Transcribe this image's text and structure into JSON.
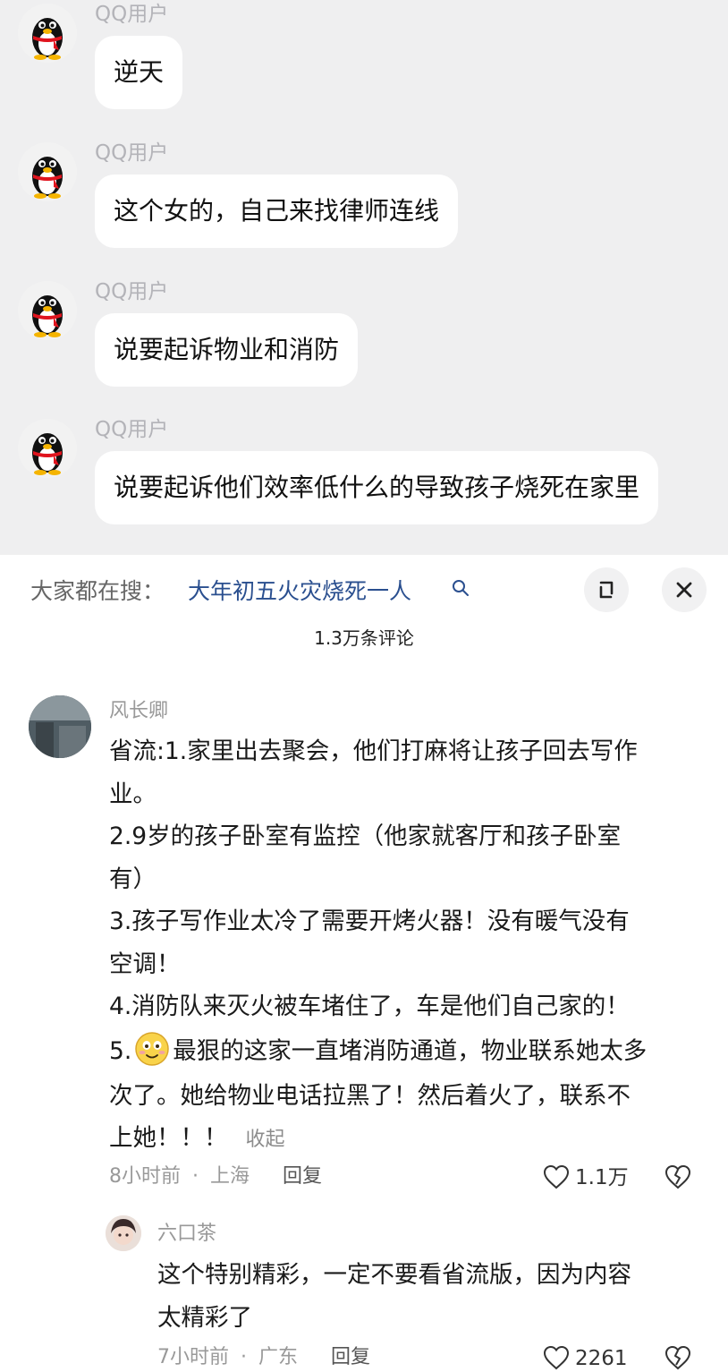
{
  "chat": {
    "messages": [
      {
        "sender": "QQ用户",
        "text": "逆天"
      },
      {
        "sender": "QQ用户",
        "text": "这个女的，自己来找律师连线"
      },
      {
        "sender": "QQ用户",
        "text": "说要起诉物业和消防"
      },
      {
        "sender": "QQ用户",
        "text": "说要起诉他们效率低什么的导致孩子烧死在家里"
      }
    ]
  },
  "panel": {
    "search_prefix": "大家都在搜：",
    "search_term": "大年初五火灾烧死一人",
    "comment_count": "1.3万条评论",
    "icons": {
      "search": "search-icon",
      "expand": "expand-icon",
      "close": "close-icon"
    }
  },
  "comments": [
    {
      "author": "风长卿",
      "lines": [
        "省流:1.家里出去聚会，他们打麻将让孩子回去写作",
        "业。",
        "2.9岁的孩子卧室有监控（他家就客厅和孩子卧室",
        "有）",
        "3.孩子写作业太冷了需要开烤火器！没有暖气没有",
        "空调！",
        "4.消防队来灭火被车堵住了，车是他们自己家的！"
      ],
      "line5_prefix": "5.",
      "line5_emoji": "smiling-face-emoji",
      "line5_rest": "最狠的这家一直堵消防通道，物业联系她太多",
      "line6": "次了。她给物业电话拉黑了！然后着火了，联系不",
      "line7": "上她！！！",
      "collapse": "收起",
      "time": "8小时前",
      "sep": "·",
      "location": "上海",
      "reply": "回复",
      "likes": "1.1万"
    },
    {
      "author": "六口茶",
      "lines": [
        "这个特别精彩，一定不要看省流版，因为内容",
        "太精彩了"
      ],
      "time": "7小时前",
      "sep": "·",
      "location": "广东",
      "reply": "回复",
      "likes": "2261"
    }
  ]
}
